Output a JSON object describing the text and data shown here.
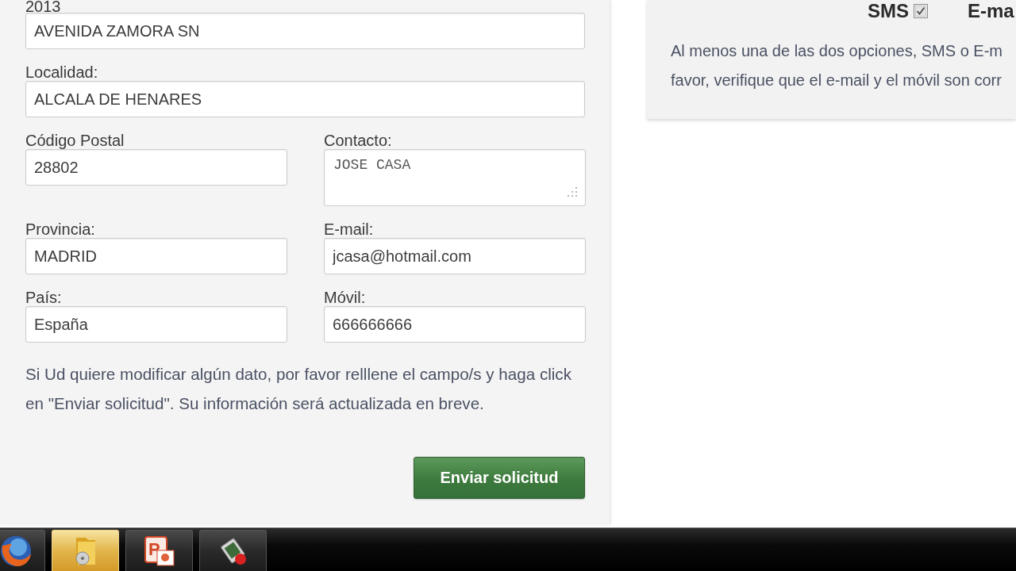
{
  "form": {
    "rows": [
      {
        "fields": [
          {
            "label": "2013",
            "kind": "input",
            "value": "AVENIDA ZAMORA SN"
          }
        ]
      },
      {
        "fields": [
          {
            "label": "Localidad:",
            "kind": "input",
            "value": "ALCALA DE HENARES"
          }
        ]
      },
      {
        "fields": [
          {
            "label": "Código Postal",
            "kind": "input",
            "value": "28802"
          },
          {
            "label": "Contacto:",
            "kind": "textarea",
            "value": "JOSE CASA"
          }
        ]
      },
      {
        "fields": [
          {
            "label": "Provincia:",
            "kind": "input",
            "value": "MADRID"
          },
          {
            "label": "E-mail:",
            "kind": "input",
            "value": "jcasa@hotmail.com"
          }
        ]
      },
      {
        "fields": [
          {
            "label": "País:",
            "kind": "input",
            "value": "España"
          },
          {
            "label": "Móvil:",
            "kind": "input",
            "value": "666666666"
          }
        ]
      }
    ],
    "note": "Si Ud quiere modificar algún dato, por favor relllene el campo/s y haga click en \"Enviar solicitud\". Su información será actualizada en breve.",
    "submit_button": {
      "label": "Enviar solicitud"
    }
  },
  "notice_panel": {
    "options": [
      {
        "label": "SMS",
        "checked": true
      },
      {
        "label": "E-ma"
      }
    ],
    "lines": [
      "Al menos una de las dos opciones, SMS o E-m",
      "favor, verifique que el e-mail y el móvil son corr"
    ]
  },
  "taskbar": {
    "items": [
      {
        "kind": "browser",
        "selected": false
      },
      {
        "kind": "folder",
        "selected": true
      },
      {
        "kind": "presentation",
        "glyph": "P",
        "selected": false
      },
      {
        "kind": "recorder",
        "selected": false
      }
    ]
  }
}
